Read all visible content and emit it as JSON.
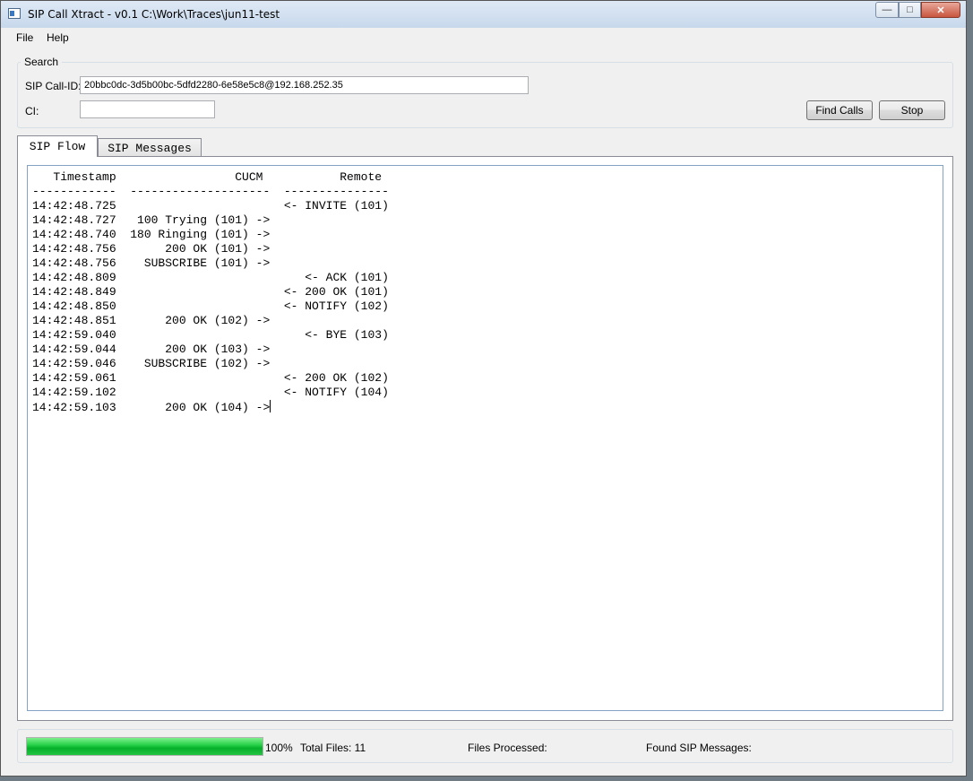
{
  "window": {
    "title": "SIP Call Xtract - v0.1 C:\\Work\\Traces\\jun11-test",
    "minimize_glyph": "—",
    "maximize_glyph": "□",
    "close_glyph": "✕"
  },
  "menu": {
    "file": "File",
    "help": "Help"
  },
  "search": {
    "group_title": "Search",
    "call_id_label": "SIP Call-ID:",
    "call_id_value": "20bbc0dc-3d5b00bc-5dfd2280-6e58e5c8@192.168.252.35",
    "ci_label": "CI:",
    "ci_value": "",
    "find_button": "Find Calls",
    "stop_button": "Stop"
  },
  "tabs": {
    "flow": "SIP Flow",
    "messages": "SIP Messages"
  },
  "flow": {
    "lines": [
      "   Timestamp                 CUCM           Remote",
      "------------  --------------------  ---------------",
      "14:42:48.725                        <- INVITE (101)",
      "14:42:48.727   100 Trying (101) ->",
      "14:42:48.740  180 Ringing (101) ->",
      "14:42:48.756       200 OK (101) ->",
      "14:42:48.756    SUBSCRIBE (101) ->",
      "14:42:48.809                           <- ACK (101)",
      "14:42:48.849                        <- 200 OK (101)",
      "14:42:48.850                        <- NOTIFY (102)",
      "14:42:48.851       200 OK (102) ->",
      "14:42:59.040                           <- BYE (103)",
      "14:42:59.044       200 OK (103) ->",
      "14:42:59.046    SUBSCRIBE (102) ->",
      "14:42:59.061                        <- 200 OK (102)",
      "14:42:59.102                        <- NOTIFY (104)",
      "14:42:59.103       200 OK (104) ->"
    ]
  },
  "status": {
    "progress": 1.0,
    "progress_text": "100%",
    "total_files": "Total Files: 11",
    "files_processed": "Files Processed:",
    "found_sip": "Found SIP Messages:"
  }
}
